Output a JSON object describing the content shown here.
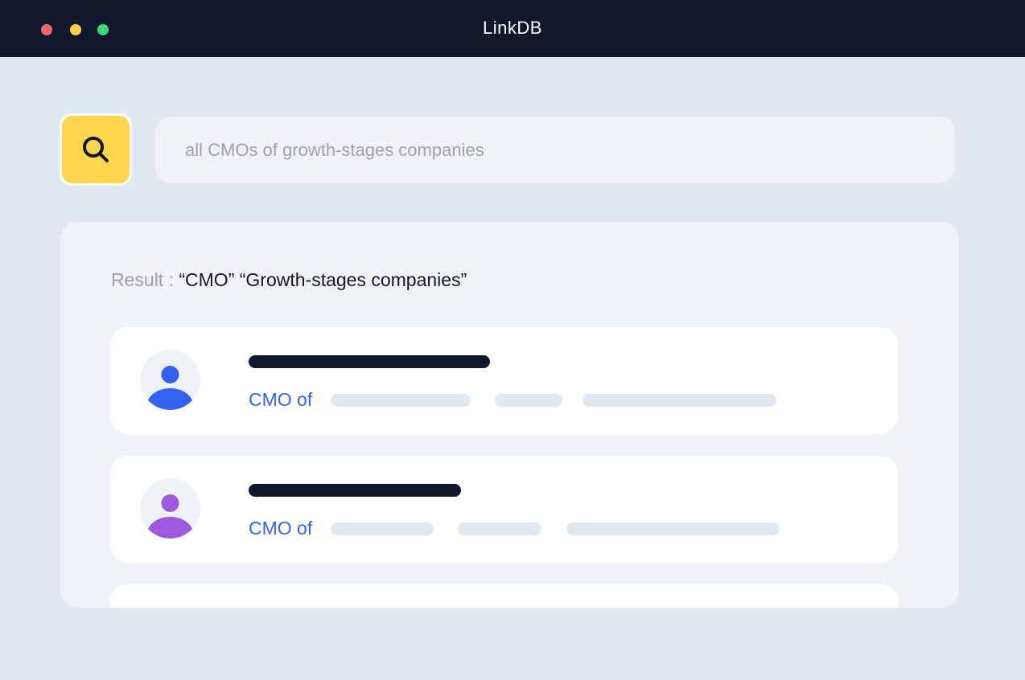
{
  "window": {
    "title": "LinkDB",
    "controls": [
      {
        "name": "close",
        "color": "#f0656f"
      },
      {
        "name": "minimize",
        "color": "#f9d048"
      },
      {
        "name": "maximize",
        "color": "#3fd67a"
      }
    ]
  },
  "search": {
    "icon": "search-icon",
    "button_color": "#ffd54e",
    "value": "",
    "placeholder": "all CMOs of growth-stages companies"
  },
  "results": {
    "prefix": "Result : ",
    "query": "“CMO” “Growth-stages companies”",
    "items": [
      {
        "role": "CMO of",
        "avatar_icon": "user-avatar-icon",
        "avatar_color": "#3462f0"
      },
      {
        "role": "CMO of",
        "avatar_icon": "user-avatar-icon",
        "avatar_color": "#9b5bdc"
      }
    ]
  },
  "colors": {
    "titlebar": "#10182b",
    "accent": "#3462f0",
    "background": "#e1e8f0"
  }
}
